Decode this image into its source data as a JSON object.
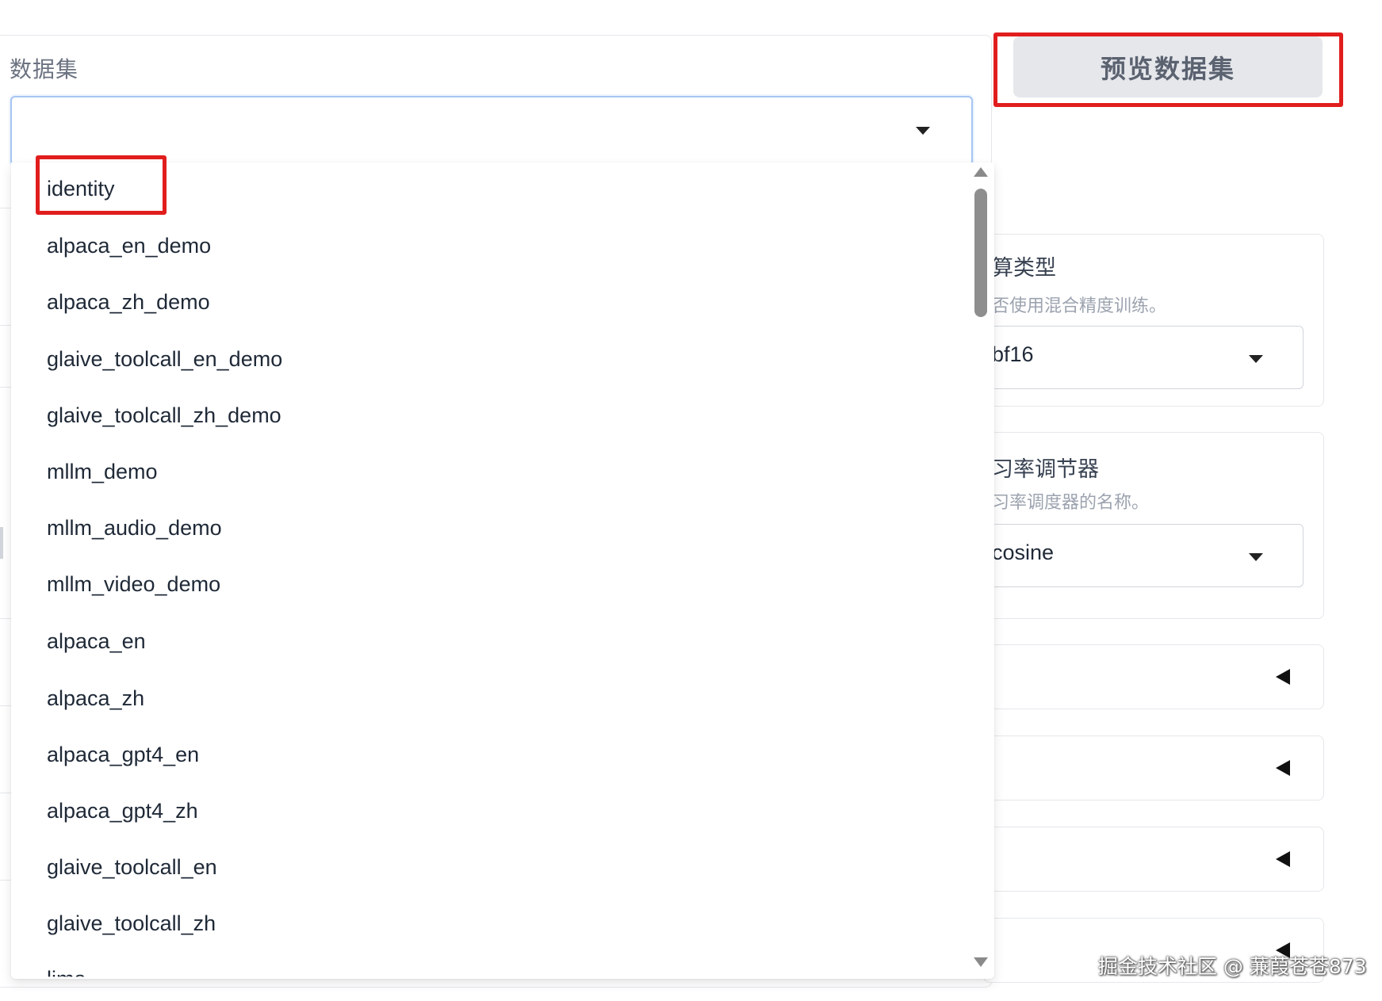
{
  "dataset": {
    "label": "数据集",
    "selected_value": "",
    "options": [
      "identity",
      "alpaca_en_demo",
      "alpaca_zh_demo",
      "glaive_toolcall_en_demo",
      "glaive_toolcall_zh_demo",
      "mllm_demo",
      "mllm_audio_demo",
      "mllm_video_demo",
      "alpaca_en",
      "alpaca_zh",
      "alpaca_gpt4_en",
      "alpaca_gpt4_zh",
      "glaive_toolcall_en",
      "glaive_toolcall_zh",
      "lima"
    ],
    "highlighted_option": "identity"
  },
  "preview_button": {
    "label": "预览数据集"
  },
  "compute_type": {
    "title": "算类型",
    "info": "否使用混合精度训练。",
    "value": "bf16"
  },
  "lr_scheduler": {
    "title": "习率调节器",
    "info": "习率调度器的名称。",
    "value": "cosine"
  },
  "collapsed_sections": [
    "",
    "",
    "",
    ""
  ],
  "watermark": "掘金技术社区 @ 蒹葭苍苍873",
  "colors": {
    "highlight": "#e11d1d",
    "select_focus_border": "#a7c5f2",
    "button_bg": "#e5e7eb"
  }
}
